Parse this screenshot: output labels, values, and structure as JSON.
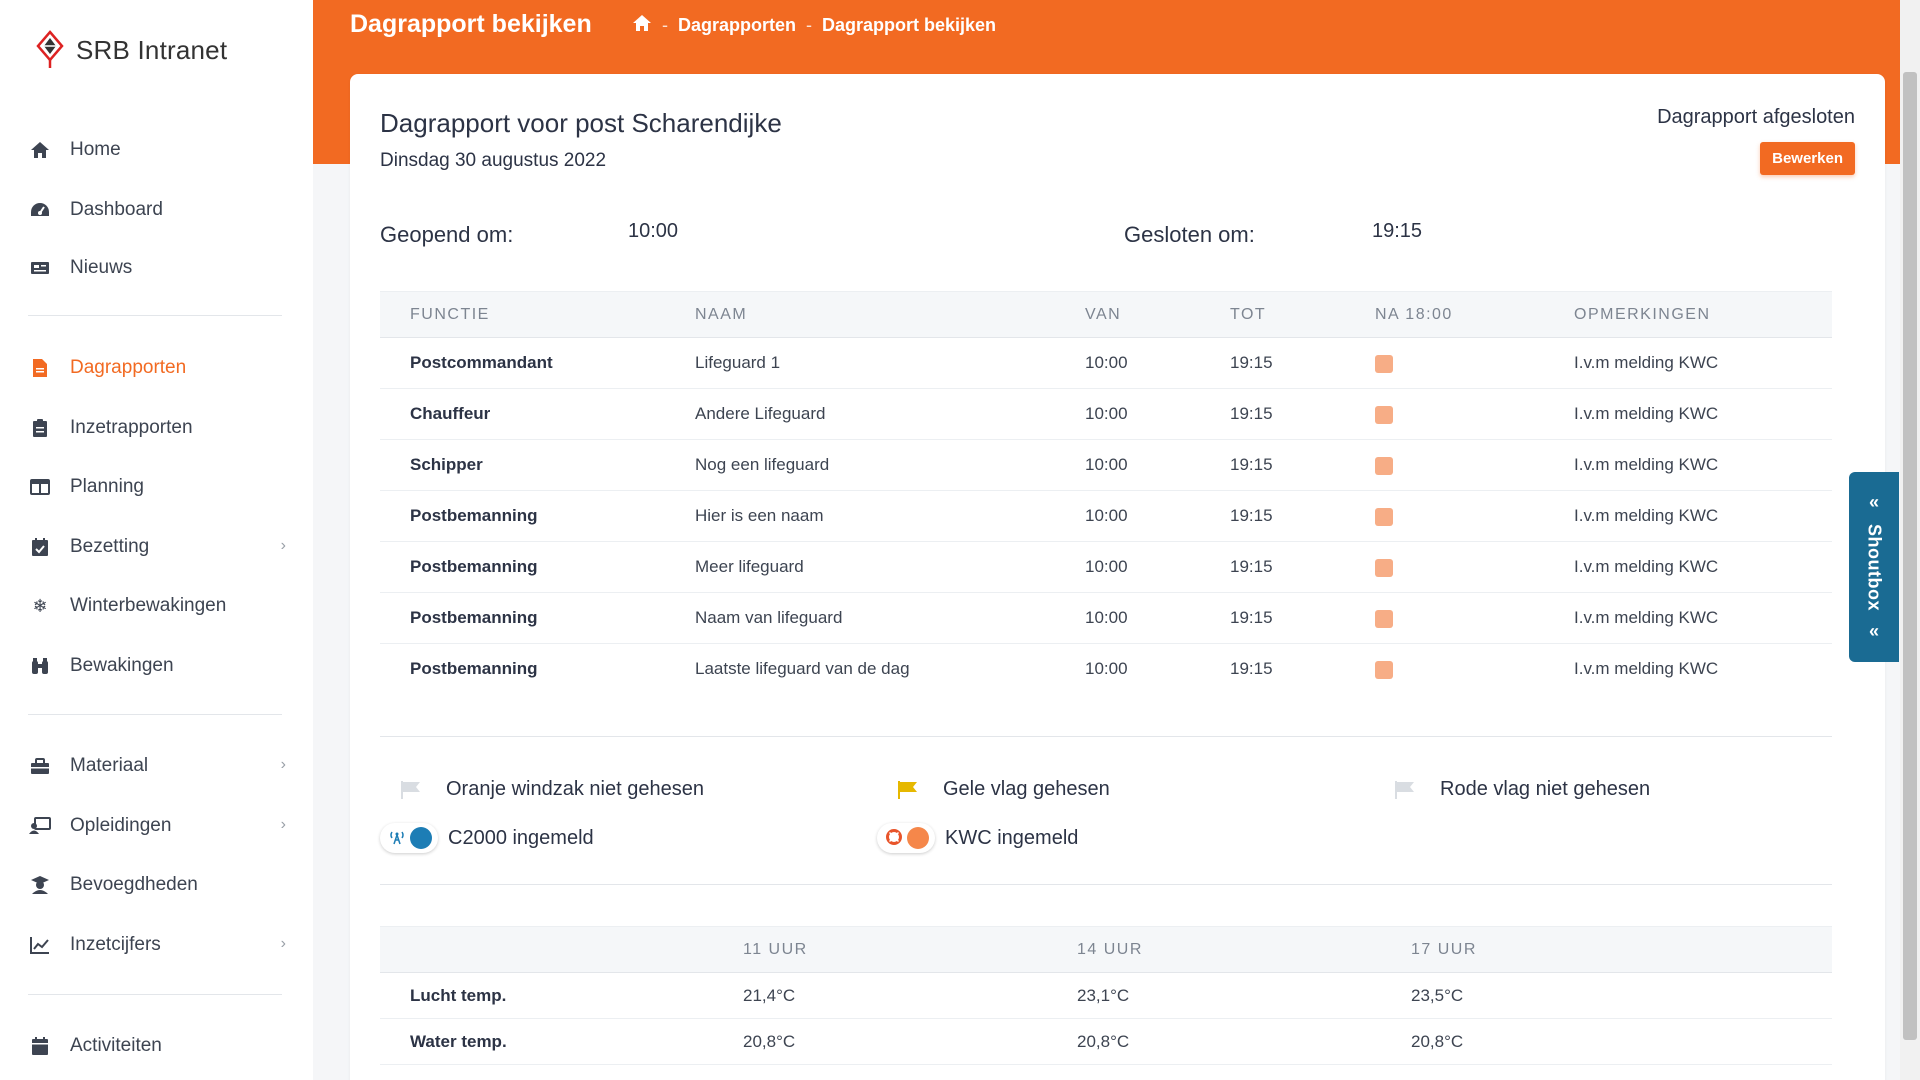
{
  "app": {
    "name": "SRB Intranet"
  },
  "sidebar": {
    "items": [
      {
        "label": "Home",
        "icon": "home-icon"
      },
      {
        "label": "Dashboard",
        "icon": "dashboard-icon"
      },
      {
        "label": "Nieuws",
        "icon": "news-icon"
      },
      {
        "label": "Dagrapporten",
        "icon": "file-icon"
      },
      {
        "label": "Inzetrapporten",
        "icon": "clipboard-icon"
      },
      {
        "label": "Planning",
        "icon": "columns-icon"
      },
      {
        "label": "Bezetting",
        "icon": "calendar-check-icon"
      },
      {
        "label": "Winterbewakingen",
        "icon": "snowflake-icon"
      },
      {
        "label": "Bewakingen",
        "icon": "binoculars-icon"
      },
      {
        "label": "Materiaal",
        "icon": "toolbox-icon"
      },
      {
        "label": "Opleidingen",
        "icon": "teacher-icon"
      },
      {
        "label": "Bevoegdheden",
        "icon": "graduate-icon"
      },
      {
        "label": "Inzetcijfers",
        "icon": "chart-line-icon"
      },
      {
        "label": "Activiteiten",
        "icon": "calendar-icon"
      }
    ],
    "active": "Dagrapporten"
  },
  "header": {
    "title": "Dagrapport bekijken",
    "breadcrumb": [
      "Dagrapporten",
      "Dagrapport bekijken"
    ]
  },
  "report": {
    "title": "Dagrapport voor post Scharendijke",
    "date": "Dinsdag 30 augustus 2022",
    "status": "Dagrapport afgesloten",
    "edit_label": "Bewerken",
    "opened_label": "Geopend om:",
    "opened_value": "10:00",
    "closed_label": "Gesloten om:",
    "closed_value": "19:15"
  },
  "crew": {
    "headers": [
      "FUNCTIE",
      "NAAM",
      "VAN",
      "TOT",
      "NA 18:00",
      "OPMERKINGEN"
    ],
    "rows": [
      {
        "functie": "Postcommandant",
        "naam": "Lifeguard 1",
        "van": "10:00",
        "tot": "19:15",
        "opm": "I.v.m melding KWC"
      },
      {
        "functie": "Chauffeur",
        "naam": "Andere Lifeguard",
        "van": "10:00",
        "tot": "19:15",
        "opm": "I.v.m melding KWC"
      },
      {
        "functie": "Schipper",
        "naam": "Nog een lifeguard",
        "van": "10:00",
        "tot": "19:15",
        "opm": "I.v.m melding KWC"
      },
      {
        "functie": "Postbemanning",
        "naam": "Hier is een naam",
        "van": "10:00",
        "tot": "19:15",
        "opm": "I.v.m melding KWC"
      },
      {
        "functie": "Postbemanning",
        "naam": "Meer lifeguard",
        "van": "10:00",
        "tot": "19:15",
        "opm": "I.v.m melding KWC"
      },
      {
        "functie": "Postbemanning",
        "naam": "Naam van lifeguard",
        "van": "10:00",
        "tot": "19:15",
        "opm": "I.v.m melding KWC"
      },
      {
        "functie": "Postbemanning",
        "naam": "Laatste lifeguard van de dag",
        "van": "10:00",
        "tot": "19:15",
        "opm": "I.v.m melding KWC"
      }
    ]
  },
  "flags": [
    {
      "label": "Oranje windzak niet gehesen",
      "seen": false,
      "color": "#d9dde2"
    },
    {
      "label": "Gele vlag gehesen",
      "seen": true,
      "color": "#e6b800"
    },
    {
      "label": "Rode vlag niet gehesen",
      "seen": false,
      "color": "#d9dde2"
    }
  ],
  "registrations": [
    {
      "label": "C2000 ingemeld",
      "icon": "radio-tower-icon",
      "color": "#1d7db5"
    },
    {
      "label": "KWC ingemeld",
      "icon": "lifebuoy-icon",
      "color": "#f5874a"
    }
  ],
  "weather": {
    "headers": [
      "",
      "11 UUR",
      "14 UUR",
      "17 UUR"
    ],
    "rows": [
      {
        "label": "Lucht temp.",
        "values": [
          "21,4°C",
          "23,1°C",
          "23,5°C"
        ]
      },
      {
        "label": "Water temp.",
        "values": [
          "20,8°C",
          "20,8°C",
          "20,8°C"
        ]
      }
    ]
  },
  "shoutbox": {
    "label": "Shoutbox"
  },
  "colors": {
    "accent": "#f26a22",
    "shoutbox": "#1a6b93",
    "box": "#f7ad86"
  }
}
